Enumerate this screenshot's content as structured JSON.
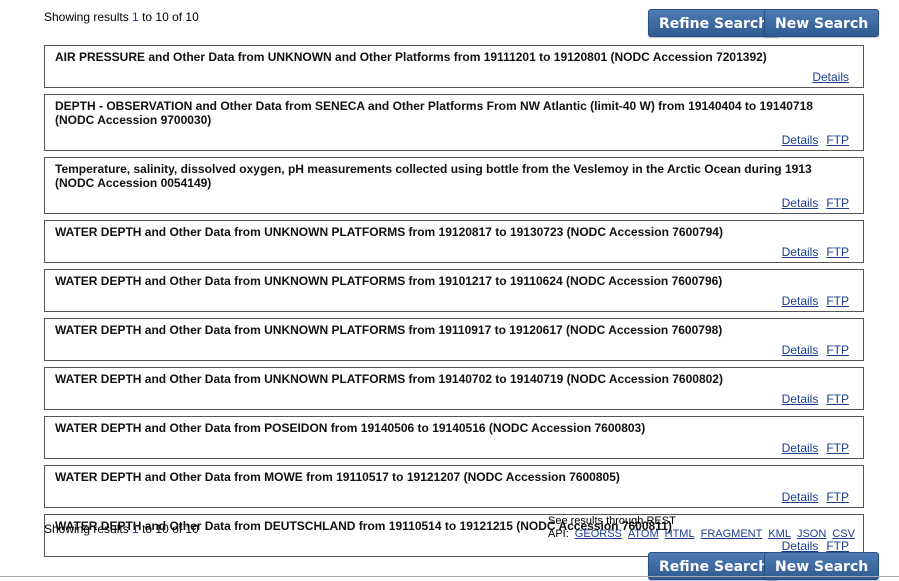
{
  "summary_top": {
    "prefix": "Showing results ",
    "start": "1",
    "mid": " to 10 of 10"
  },
  "summary_bottom": {
    "prefix": "Showing results ",
    "start": "1",
    "mid": " to 10 of 10"
  },
  "buttons": {
    "refine": "Refine Search",
    "new": "New Search"
  },
  "links": {
    "details": "Details",
    "ftp": "FTP"
  },
  "results": [
    {
      "title": "AIR PRESSURE and Other Data from UNKNOWN and Other Platforms from 19111201 to 19120801 (NODC Accession 7201392)",
      "ftp": false
    },
    {
      "title": "DEPTH - OBSERVATION and Other Data from SENECA and Other Platforms From NW Atlantic (limit-40 W) from 19140404 to 19140718 (NODC Accession 9700030)",
      "ftp": true
    },
    {
      "title": "Temperature, salinity, dissolved oxygen, pH measurements collected using bottle from the Veslemoy in the Arctic Ocean during 1913 (NODC Accession 0054149)",
      "ftp": true
    },
    {
      "title": "WATER DEPTH and Other Data from UNKNOWN PLATFORMS from 19120817 to 19130723 (NODC Accession 7600794)",
      "ftp": true
    },
    {
      "title": "WATER DEPTH and Other Data from UNKNOWN PLATFORMS from 19101217 to 19110624 (NODC Accession 7600796)",
      "ftp": true
    },
    {
      "title": "WATER DEPTH and Other Data from UNKNOWN PLATFORMS from 19110917 to 19120617 (NODC Accession 7600798)",
      "ftp": true
    },
    {
      "title": "WATER DEPTH and Other Data from UNKNOWN PLATFORMS from 19140702 to 19140719 (NODC Accession 7600802)",
      "ftp": true
    },
    {
      "title": "WATER DEPTH and Other Data from POSEIDON from 19140506 to 19140516 (NODC Accession 7600803)",
      "ftp": true
    },
    {
      "title": "WATER DEPTH and Other Data from MOWE from 19110517 to 19121207 (NODC Accession 7600805)",
      "ftp": true
    },
    {
      "title": "WATER DEPTH and Other Data from DEUTSCHLAND from 19110514 to 19121215 (NODC Accession 7600811)",
      "ftp": true
    }
  ],
  "api": {
    "line1": "See results through REST",
    "label": "API:",
    "formats": [
      "GEORSS",
      "ATOM",
      "HTML",
      "FRAGMENT",
      "KML",
      "JSON",
      "CSV"
    ]
  },
  "colors": {
    "button": "#3a68a3",
    "link": "#1a3d8f"
  }
}
